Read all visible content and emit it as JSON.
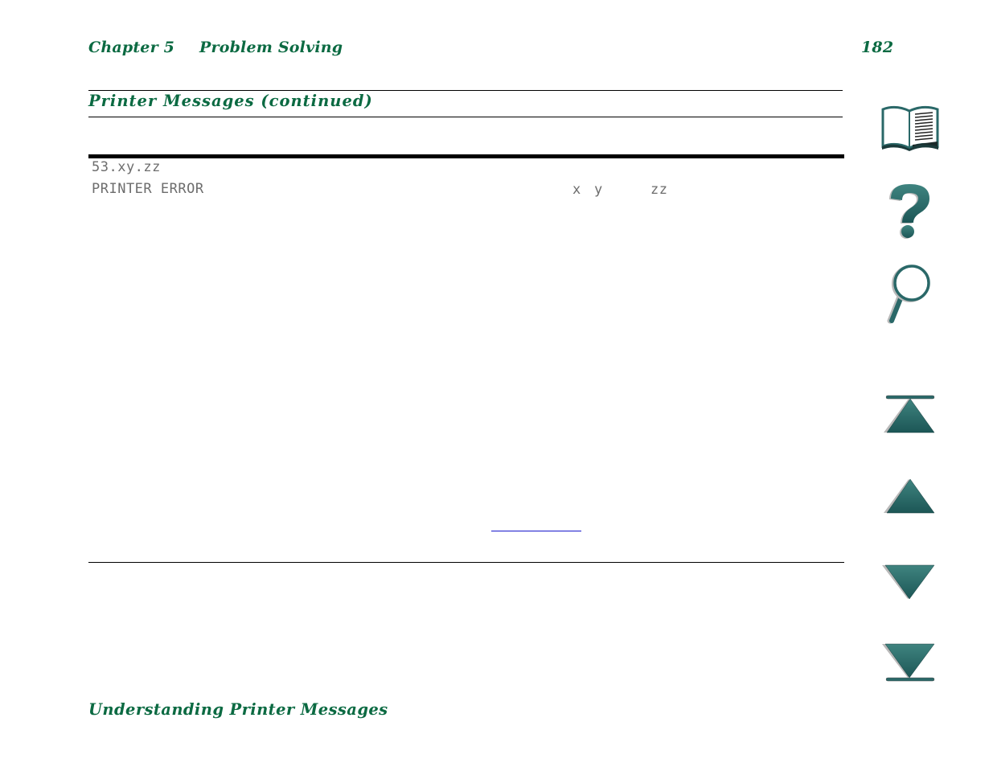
{
  "header": {
    "chapter": "Chapter 5",
    "chapter_title": "Problem Solving",
    "page_number": "182"
  },
  "section": {
    "title": "Printer Messages  (continued)"
  },
  "message_table": {
    "rows": [
      {
        "code": "53.xy.zz",
        "message": "PRINTER ERROR",
        "variables": [
          "x",
          "y",
          "zz"
        ]
      }
    ]
  },
  "footer": {
    "title": "Understanding Printer Messages"
  },
  "nav": {
    "items": [
      {
        "name": "contents",
        "icon": "book-icon"
      },
      {
        "name": "help",
        "icon": "question-mark-icon"
      },
      {
        "name": "index",
        "icon": "magnifier-icon"
      },
      {
        "name": "first-page",
        "icon": "first-page-icon"
      },
      {
        "name": "previous-page",
        "icon": "previous-page-icon"
      },
      {
        "name": "next-page",
        "icon": "next-page-icon"
      },
      {
        "name": "last-page",
        "icon": "last-page-icon"
      }
    ],
    "color": "#2a6868"
  },
  "colors": {
    "heading_green": "#0b6a42",
    "link_blue": "#1515cc",
    "lcd_text_gray": "#6d6d6d"
  }
}
